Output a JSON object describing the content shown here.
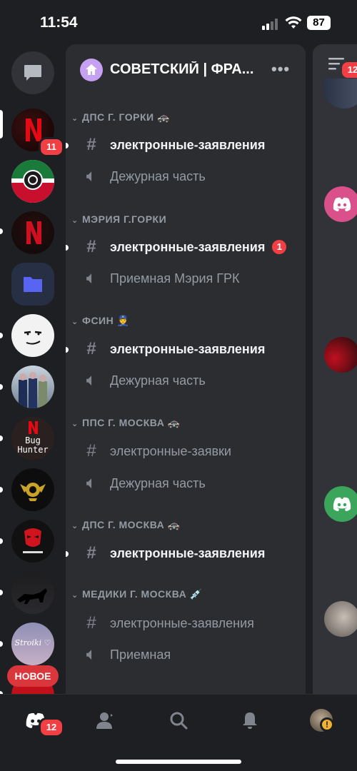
{
  "status_bar": {
    "time": "11:54",
    "battery": "87"
  },
  "rail": {
    "servers": [
      {
        "name": "server-red-n",
        "badge": "11"
      },
      {
        "name": "server-chechen-flag"
      },
      {
        "name": "server-dark-n"
      },
      {
        "name": "server-folder"
      },
      {
        "name": "server-face"
      },
      {
        "name": "server-officers"
      },
      {
        "name": "server-bug-hunter",
        "label_line1": "Bug",
        "label_line2": "Hunter"
      },
      {
        "name": "server-gold-emblem"
      },
      {
        "name": "server-red-mask"
      },
      {
        "name": "server-wolf"
      },
      {
        "name": "server-stroiki",
        "label": "Stroiki ♡"
      }
    ],
    "new_label": "НОВОЕ"
  },
  "server": {
    "name": "СОВЕТСКИЙ | ФРА...",
    "more": "•••"
  },
  "categories": [
    {
      "title": "ДПС Г. ГОРКИ 🚓",
      "channels": [
        {
          "type": "text",
          "name": "электронные-заявления",
          "unread": true
        },
        {
          "type": "voice",
          "name": "Дежурная часть",
          "unread": false
        }
      ]
    },
    {
      "title": "МЭРИЯ Г.ГОРКИ",
      "channels": [
        {
          "type": "text",
          "name": "электронные-заявления",
          "unread": true,
          "badge": "1"
        },
        {
          "type": "voice",
          "name": "Приемная Мэрия ГРК",
          "unread": false
        }
      ]
    },
    {
      "title": "ФСИН 👮",
      "channels": [
        {
          "type": "text",
          "name": "электронные-заявления",
          "unread": true
        },
        {
          "type": "voice",
          "name": "Дежурная часть",
          "unread": false
        }
      ]
    },
    {
      "title": "ППС Г. МОСКВА 🚓",
      "channels": [
        {
          "type": "text",
          "name": "электронные-заявки",
          "unread": false
        },
        {
          "type": "voice",
          "name": "Дежурная часть",
          "unread": false
        }
      ]
    },
    {
      "title": "ДПС Г. МОСКВА 🚓",
      "channels": [
        {
          "type": "text",
          "name": "электронные-заявления",
          "unread": true
        }
      ]
    },
    {
      "title": "МЕДИКИ Г. МОСКВА 💉",
      "channels": [
        {
          "type": "text",
          "name": "электронные-заявления",
          "unread": false
        },
        {
          "type": "voice",
          "name": "Приемная",
          "unread": false
        }
      ]
    }
  ],
  "peek": {
    "badge": "12"
  },
  "tabbar": {
    "home_badge": "12"
  },
  "colors": {
    "accent": "#5865f2",
    "badge": "#f23f43",
    "panel": "#2b2d31",
    "rail": "#1e1f22"
  }
}
